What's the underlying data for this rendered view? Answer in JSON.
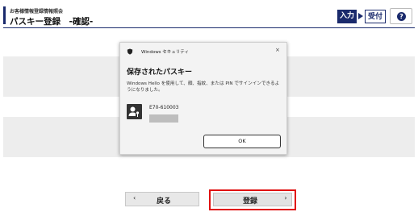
{
  "header": {
    "breadcrumb": "お客様情報登録情報照会",
    "title": "パスキー登録　-確認-",
    "steps": {
      "input": "入力",
      "done": "受付"
    },
    "help_label": "?"
  },
  "dialog": {
    "window_title": "Windows セキュリティ",
    "close_label": "×",
    "heading": "保存されたパスキー",
    "description": "Windows Hello を使用して、顔、指紋、または PIN でサインインできるようになりました。",
    "account_name": "E70-610003",
    "ok_label": "OK"
  },
  "buttons": {
    "back_label": "戻る",
    "back_chevron": "‹",
    "register_label": "登録",
    "register_chevron": "›"
  },
  "colors": {
    "navy": "#1a2a6c",
    "highlight": "#e01010"
  }
}
